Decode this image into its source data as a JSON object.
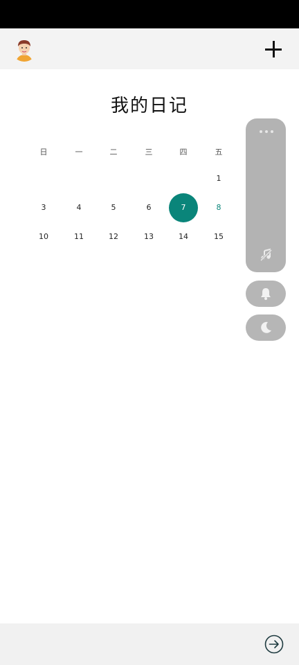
{
  "header": {
    "avatar_icon": "user-avatar"
  },
  "page": {
    "title": "我的日记"
  },
  "calendar": {
    "weekdays": [
      "日",
      "一",
      "二",
      "三",
      "四",
      "五"
    ],
    "week1": [
      "1"
    ],
    "week2": [
      "3",
      "4",
      "5",
      "6",
      "7",
      "8"
    ],
    "week3": [
      "10",
      "11",
      "12",
      "13",
      "14",
      "15"
    ],
    "selected_day": "7",
    "today_day": "8",
    "accent_color": "#0a857a"
  },
  "floating_panel": {
    "icons": [
      "more-dots-icon",
      "music-off-icon",
      "bell-icon",
      "moon-icon"
    ]
  },
  "bottom": {
    "placeholder": "",
    "send_icon": "arrow-right-circle-icon"
  }
}
